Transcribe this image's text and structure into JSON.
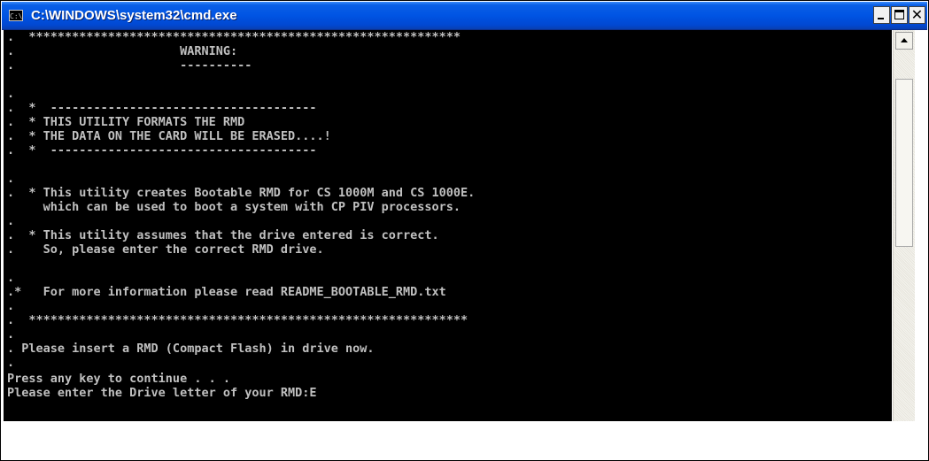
{
  "window": {
    "title": "C:\\WINDOWS\\system32\\cmd.exe",
    "icon_text": "C:\\",
    "controls": {
      "minimize_icon": "minimize-icon",
      "maximize_icon": "maximize-icon",
      "close_icon": "close-icon",
      "close_glyph": "✕"
    }
  },
  "console": {
    "lines": [
      ".  ************************************************************",
      ".                       WARNING:",
      ".                       ----------",
      ".",
      ".  *  -------------------------------------",
      ".  * THIS UTILITY FORMATS THE RMD",
      ".  * THE DATA ON THE CARD WILL BE ERASED....!",
      ".  *  -------------------------------------",
      ".",
      ".  * This utility creates Bootable RMD for CS 1000M and CS 1000E.",
      "     which can be used to boot a system with CP PIV processors.",
      ".",
      ".  * This utility assumes that the drive entered is correct.",
      ".    So, please enter the correct RMD drive.",
      ".",
      ".*   For more information please read README_BOOTABLE_RMD.txt",
      ".",
      ".  *************************************************************",
      ".",
      ". Please insert a RMD (Compact Flash) in drive now.",
      ".",
      "Press any key to continue . . .",
      "Please enter the Drive letter of your RMD:E"
    ]
  },
  "colors": {
    "console_bg": "#000000",
    "console_fg": "#c0c0c0",
    "titlebar": "#0054e3"
  }
}
